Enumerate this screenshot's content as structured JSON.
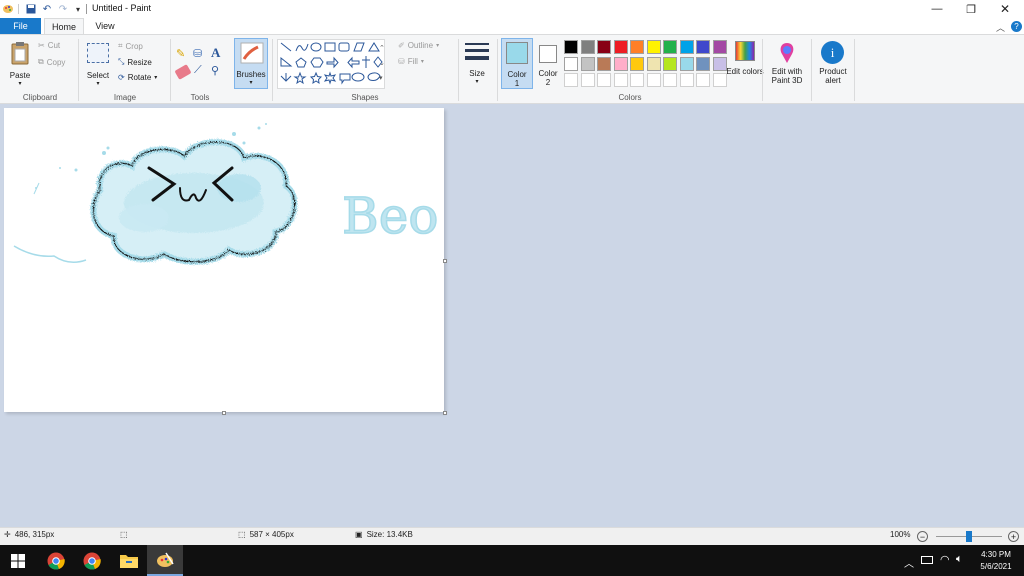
{
  "window": {
    "title": "Untitled - Paint"
  },
  "tabs": {
    "file": "File",
    "home": "Home",
    "view": "View"
  },
  "ribbon": {
    "clipboard": {
      "paste": "Paste",
      "cut": "Cut",
      "copy": "Copy",
      "label": "Clipboard"
    },
    "image": {
      "select": "Select",
      "crop": "Crop",
      "resize": "Resize",
      "rotate": "Rotate",
      "label": "Image"
    },
    "tools": {
      "label": "Tools"
    },
    "brushes": {
      "label": "Brushes"
    },
    "shapes": {
      "outline": "Outline",
      "fill": "Fill",
      "label": "Shapes"
    },
    "size": {
      "label": "Size"
    },
    "colors": {
      "color1": "Color",
      "color1_num": "1",
      "color2": "Color",
      "color2_num": "2",
      "edit": "Edit colors",
      "label": "Colors",
      "color1_value": "#99d9ea",
      "color2_value": "#ffffff",
      "palette_row1": [
        "#000000",
        "#7f7f7f",
        "#880015",
        "#ed1c24",
        "#ff7f27",
        "#fff200",
        "#22b14c",
        "#00a2e8",
        "#3f48cc",
        "#a349a4"
      ],
      "palette_row2": [
        "#ffffff",
        "#c3c3c3",
        "#b97a57",
        "#ffaec9",
        "#ffc90e",
        "#efe4b0",
        "#b5e61d",
        "#99d9ea",
        "#7092be",
        "#c8bfe7"
      ]
    },
    "paint3d": "Edit with Paint 3D",
    "product_alert": "Product alert"
  },
  "canvas": {
    "text": "Beo",
    "ink_color": "#a6dbe9"
  },
  "status": {
    "cursor": "486, 315px",
    "selection_size": "",
    "canvas_size": "587 × 405px",
    "file_size": "Size: 13.4KB",
    "zoom": "100%",
    "zoom_level": 0.5
  },
  "taskbar": {
    "time": "4:30 PM",
    "date": "5/6/2021"
  }
}
